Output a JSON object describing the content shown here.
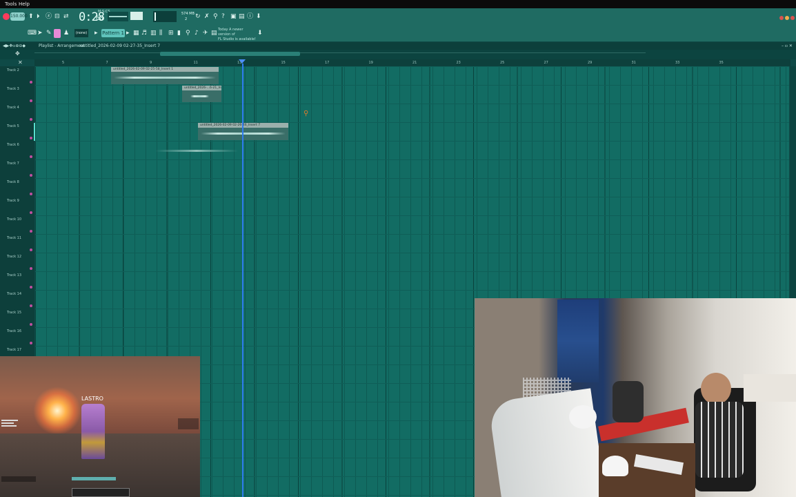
{
  "menu": {
    "items": [
      "Tools",
      "Help"
    ]
  },
  "transport": {
    "bpm": "150.000",
    "time": "0:28",
    "time_ms": "68",
    "time_label": "M:S:CS",
    "memory": "574 MB",
    "cpu_value": "2"
  },
  "toolbar2": {
    "insert_label": "(none)",
    "pattern_label": "Pattern 1",
    "news_line1": "Today A newer version of",
    "news_line2": "FL Studio is available!"
  },
  "playlist": {
    "title": "Playlist - Arrangement",
    "project": "untitled_2026-02-09 02-27-35_Insert 7",
    "ruler_numbers": [
      "5",
      "7",
      "9",
      "11",
      "13",
      "15",
      "17",
      "19",
      "21",
      "23",
      "25",
      "27",
      "29",
      "31",
      "33",
      "35"
    ],
    "tracks": [
      "Track 2",
      "Track 3",
      "Track 4",
      "Track 5",
      "Track 6",
      "Track 7",
      "Track 8",
      "Track 9",
      "Track 10",
      "Track 11",
      "Track 12",
      "Track 13",
      "Track 14",
      "Track 15",
      "Track 16",
      "Track 17"
    ],
    "clips": [
      {
        "name": "untitled_2026-02-09 02-25-58_Insert 1"
      },
      {
        "name": "untitled_2026-...6-21_Insert 1"
      },
      {
        "name": "untitled_2026-02-09 02-26-46_Insert 7"
      }
    ]
  },
  "game_overlay": {
    "player_name": "LASTRO"
  },
  "colors": {
    "accent": "#2f7cf0",
    "record": "#ff3b5c",
    "grid": "#126c63",
    "toolbar": "#1f6b62"
  }
}
